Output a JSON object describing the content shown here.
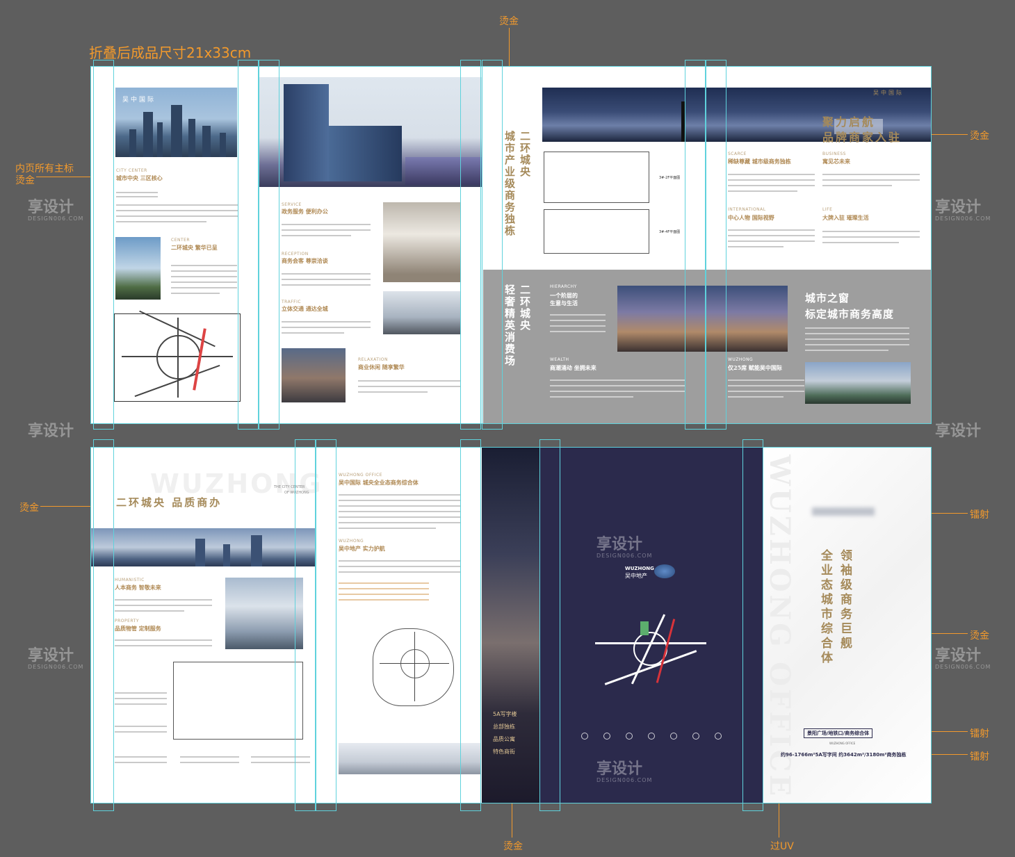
{
  "annotations": {
    "size_title": "折叠后成品尺寸21x33cm",
    "hot_gold": "烫金",
    "inner_titles_gold_line1": "内页所有主标",
    "inner_titles_gold_line2": "烫金",
    "laser": "镭射",
    "uv": "过UV"
  },
  "colors": {
    "annotation": "#f39a2c",
    "guide": "#5fd2dc",
    "navy": "#2b2a4c",
    "grey_band": "#9e9e9e",
    "gold_text": "#b08a55"
  },
  "top_sheet": {
    "panel1": {
      "logo": "吴中国际",
      "city_center_en": "CITY CENTER",
      "city_center_title": "城市中央 三区核心",
      "center_en": "CENTER",
      "center_title": "二环城央 繁华已呈"
    },
    "panel2": {
      "service_en": "SERVICE",
      "service_title": "政务服务 便利办公",
      "reception_en": "RECEPTION",
      "reception_title": "商务会客 尊崇洽谈",
      "traffic_en": "TRAFFIC",
      "traffic_title": "立体交通 通达全城",
      "relaxation_en": "RELAXATION",
      "relaxation_title": "商业休闲 随享繁华"
    },
    "panel3": {
      "vertical_title_1a": "二环城央",
      "vertical_title_1b": "城市产业级商务独栋",
      "vertical_title_2a": "二环城央",
      "vertical_title_2b": "轻奢精英消费场"
    },
    "panel4": {
      "plan_label_1": "3#-2F平面图",
      "plan_label_2": "3#-4F平面图",
      "hierarchy_en": "HIERARCHY",
      "hierarchy_title_1": "一个阶层的",
      "hierarchy_title_2": "生意与生活",
      "wealth_en": "WEALTH",
      "wealth_title": "商潮涌动 坐拥未来"
    },
    "panel5": {
      "scarce_en": "SCARCE",
      "scarce_title": "稀缺尊藏 城市级商务独栋",
      "international_en": "INTERNATIONAL",
      "international_title": "中心人物 国际视野",
      "wuzhong_en": "WUZHONG",
      "wuzhong_title": "仅25席 赋能吴中国际"
    },
    "panel6": {
      "logo": "吴中国际",
      "headline_1": "聚力启航",
      "headline_2": "品牌商家入驻",
      "business_en": "BUSINESS",
      "business_title": "寓见芯未来",
      "life_en": "LIFE",
      "life_title": "大牌入驻 璀璨生活",
      "window_title": "城市之窗",
      "window_subtitle": "标定城市商务高度"
    }
  },
  "bottom_sheet": {
    "panel1": {
      "bg_en": "WUZHONG",
      "headline": "二环城央 品质商办",
      "city_center_en_1": "THE CITY CENTER",
      "city_center_en_2": "OF WUZHONG",
      "humanistic_en": "HUMANISTIC",
      "humanistic_title": "人本商务 智敬未来",
      "property_en": "PROPERTY",
      "property_title": "品质物管 定制服务"
    },
    "panel2": {
      "office_en": "WUZHONG OFFICE",
      "office_title": "吴中国际 城央全业态商务综合体",
      "dev_en": "WUZHONG",
      "dev_title": "吴中地产 实力护航"
    },
    "panel3": {
      "items": [
        "5A写字楼",
        "总部独栋",
        "品质公寓",
        "特色商街"
      ]
    },
    "cover": {
      "brand_en": "WUZHONG",
      "brand_cn": "吴中地产"
    },
    "panel5": {
      "bg_en": "WUZHONG OFFICE",
      "vertical_col1": "领袖级商务巨舰",
      "vertical_col2": "全业态城市综合体",
      "location": "景阳广场/地铁口/商务综合体",
      "office_en": "WUZHONG OFFICE",
      "spec_line": "约96-1766m²5A写字间  约3642m²/3180m²商务独栋"
    }
  },
  "watermarks": {
    "cn": "享设计",
    "en": "DESIGN006.COM"
  }
}
